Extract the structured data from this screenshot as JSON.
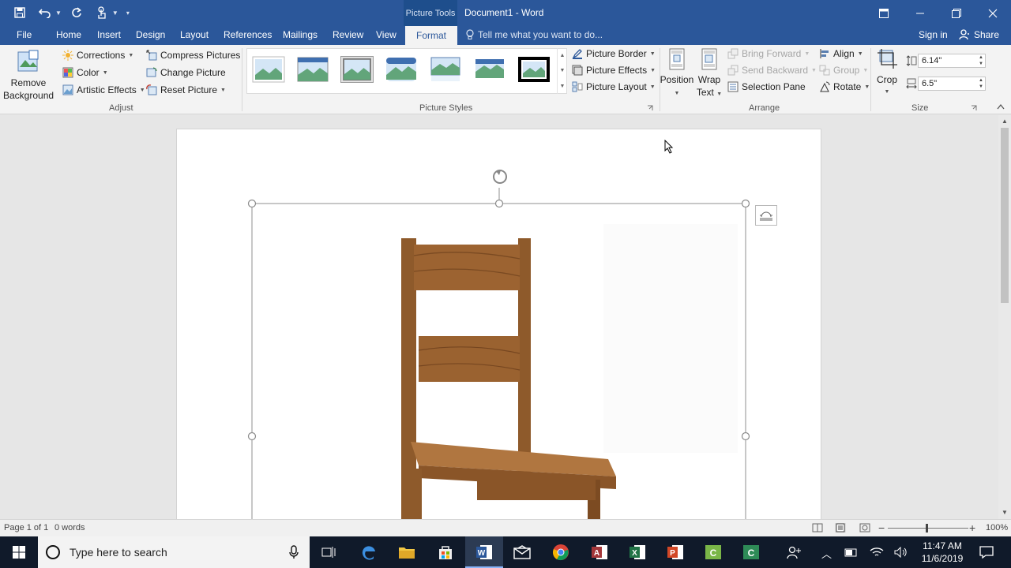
{
  "title_bar": {
    "context_label": "Picture Tools",
    "doc_title": "Document1 - Word"
  },
  "tabs": [
    {
      "label": "File"
    },
    {
      "label": "Home"
    },
    {
      "label": "Insert"
    },
    {
      "label": "Design"
    },
    {
      "label": "Layout"
    },
    {
      "label": "References"
    },
    {
      "label": "Mailings"
    },
    {
      "label": "Review"
    },
    {
      "label": "View"
    },
    {
      "label": "Format"
    }
  ],
  "tell_me": "Tell me what you want to do...",
  "sign_in": "Sign in",
  "share": "Share",
  "ribbon": {
    "adjust": {
      "remove_bg": "Remove",
      "remove_bg2": "Background",
      "corrections": "Corrections",
      "color": "Color",
      "artistic": "Artistic Effects",
      "compress": "Compress Pictures",
      "change": "Change Picture",
      "reset": "Reset Picture",
      "label": "Adjust"
    },
    "styles": {
      "border": "Picture Border",
      "effects": "Picture Effects",
      "layout": "Picture Layout",
      "label": "Picture Styles"
    },
    "arrange": {
      "position": "Position",
      "wrap": "Wrap",
      "wrap2": "Text",
      "bring_forward": "Bring Forward",
      "send_backward": "Send Backward",
      "selection_pane": "Selection Pane",
      "align": "Align",
      "group": "Group",
      "rotate": "Rotate",
      "label": "Arrange"
    },
    "size": {
      "crop": "Crop",
      "height": "6.14\"",
      "width": "6.5\"",
      "label": "Size"
    }
  },
  "status": {
    "page": "Page 1 of 1",
    "words": "0 words",
    "zoom": "100%"
  },
  "taskbar": {
    "search_placeholder": "Type here to search",
    "time": "11:47 AM",
    "date": "11/6/2019"
  },
  "colors": {
    "word_blue": "#2b579a",
    "ribbon_bg": "#f3f3f3",
    "taskbar_bg": "#101a2a"
  }
}
